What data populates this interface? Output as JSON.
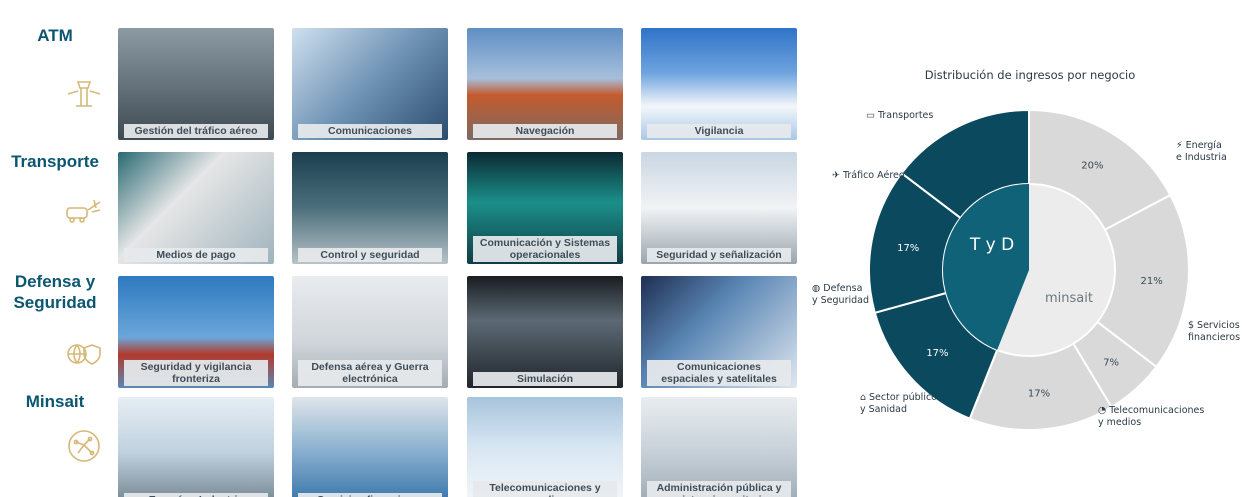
{
  "rows": [
    {
      "label": "ATM",
      "icon": "airport-tower-icon",
      "tiles": [
        "Gestión del tráfico aéreo",
        "Comunicaciones",
        "Navegación",
        "Vigilancia"
      ]
    },
    {
      "label": "Transporte",
      "icon": "train-plane-icon",
      "tiles": [
        "Medios de pago",
        "Control y seguridad",
        "Comunicación y Sistemas operacionales",
        "Seguridad y señalización"
      ]
    },
    {
      "label": "Defensa y Seguridad",
      "icon": "globe-shield-icon",
      "tiles": [
        "Seguridad y vigilancia fronteriza",
        "Defensa aérea y Guerra electrónica",
        "Simulación",
        "Comunicaciones espaciales y satelitales"
      ]
    },
    {
      "label": "Minsait",
      "icon": "network-circle-icon",
      "tiles": [
        "Energía e Industria",
        "Servicios financieros",
        "Telecomunicaciones y media",
        "Administración pública y asistencia sanitaria"
      ]
    }
  ],
  "chart_data": {
    "type": "pie",
    "variant": "donut",
    "title": "Distribución de ingresos por negocio",
    "center_labels": [
      "T y D",
      "minsait"
    ],
    "categories": [
      "Energía e Industria",
      "Servicios Financieros",
      "Telecomunicaciones y medios",
      "Sector público y Sanidad",
      "Defensa y Seguridad",
      "Tráfico Aéreo",
      "Transportes"
    ],
    "values": [
      20,
      21,
      7,
      17,
      17,
      17,
      17
    ],
    "value_labels": [
      "20%",
      "21%",
      "7%",
      "17%",
      "17%",
      "17%"
    ],
    "groups": {
      "T y D": [
        "Defensa y Seguridad",
        "Tráfico Aéreo",
        "Transportes"
      ],
      "minsait": [
        "Energía e Industria",
        "Servicios Financieros",
        "Telecomunicaciones y medios",
        "Sector público y Sanidad"
      ]
    },
    "colors": {
      "T y D": "#0b4a5e",
      "minsait": "#d9d9d9",
      "center_tyd": "#0f6277",
      "center_minsait": "#ececec"
    },
    "point_labels": [
      {
        "text": "Energía\ne Industria",
        "icon": "power-tower-icon"
      },
      {
        "text": "Servicios\nfinancieros",
        "icon": "finance-icon"
      },
      {
        "text": "Telecomunicaciones\ny medios",
        "icon": "satellite-dish-icon"
      },
      {
        "text": "Sector público\ny Sanidad",
        "icon": "public-building-icon"
      },
      {
        "text": "Defensa\ny Seguridad",
        "icon": "globe-icon"
      },
      {
        "text": "Tráfico Aéreo",
        "icon": "airplane-icon"
      },
      {
        "text": "Transportes",
        "icon": "train-icon"
      }
    ]
  }
}
